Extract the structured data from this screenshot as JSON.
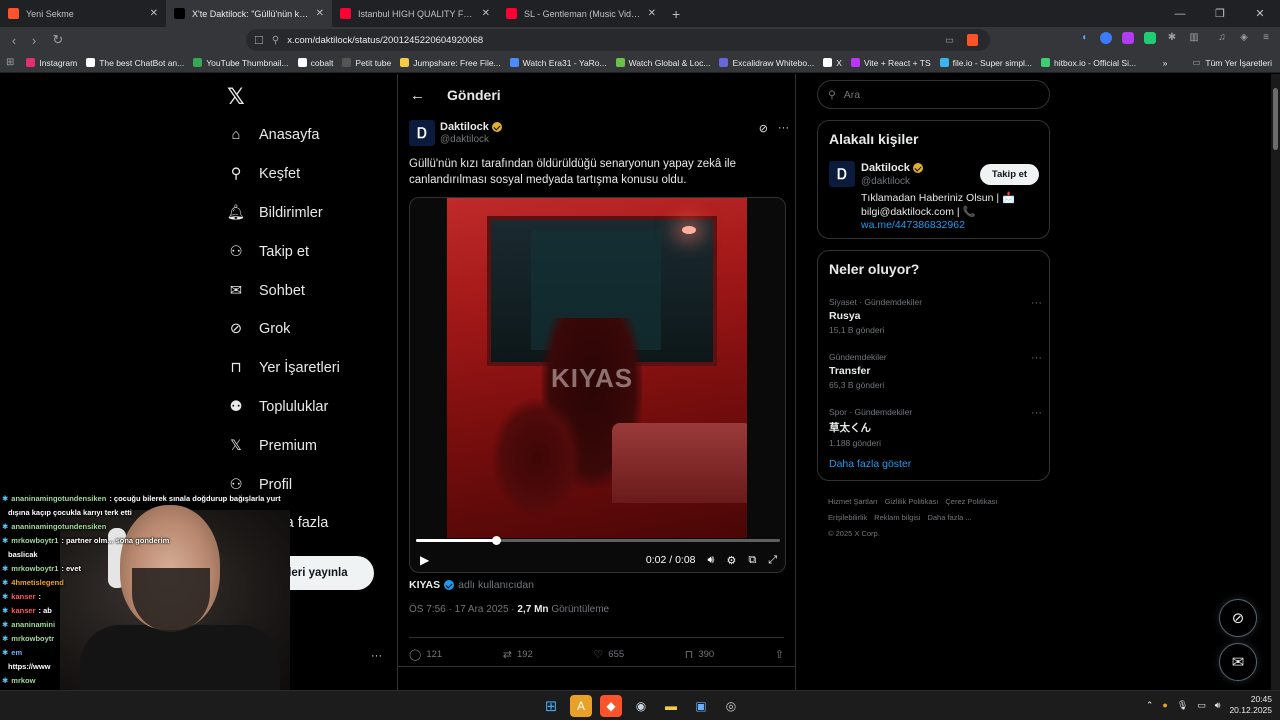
{
  "browser": {
    "tabs": [
      {
        "title": "Yeni Sekme",
        "active": false,
        "fav_color": "#fb542b"
      },
      {
        "title": "X'te Daktilock: \"Güllü'nün kızı tarafından",
        "active": true,
        "fav_color": "#000000"
      },
      {
        "title": "Istanbul HIGH QUALITY Fake Market",
        "active": false,
        "fav_color": "#ff0033"
      },
      {
        "title": "SL - Gentleman (Music Video) | @SL",
        "active": false,
        "fav_color": "#ff0033"
      }
    ],
    "new_tab": "+",
    "url": "x.com/daktilock/status/2001245220604920068",
    "bookmarks": [
      {
        "label": "Instagram",
        "color": "#e1306c"
      },
      {
        "label": "The best ChatBot an...",
        "color": "#ffffff"
      },
      {
        "label": "YouTube Thumbnail...",
        "color": "#34a853"
      },
      {
        "label": "cobalt",
        "color": "#ffffff"
      },
      {
        "label": "Petit tube",
        "color": "#555555"
      },
      {
        "label": "Jumpshare: Free File...",
        "color": "#f6c94a"
      },
      {
        "label": "Watch Era31 - YaRo...",
        "color": "#4a8cff"
      },
      {
        "label": "Watch Global & Loc...",
        "color": "#6dc04a"
      },
      {
        "label": "Excalidraw Whitebo...",
        "color": "#6965db"
      },
      {
        "label": "X",
        "color": "#ffffff"
      },
      {
        "label": "Vite + React + TS",
        "color": "#bd34fe"
      },
      {
        "label": "file.io - Super simpl...",
        "color": "#3bb4f2"
      },
      {
        "label": "hitbox.io - Official Si...",
        "color": "#3bd16f"
      }
    ],
    "bookmarks_more": "»",
    "all_bookmarks": "Tüm Yer İşaretleri"
  },
  "sidebar": {
    "items": [
      {
        "label": "Anasayfa",
        "icon": "home-icon"
      },
      {
        "label": "Keşfet",
        "icon": "search-icon"
      },
      {
        "label": "Bildirimler",
        "icon": "bell-icon"
      },
      {
        "label": "Takip et",
        "icon": "follow-icon"
      },
      {
        "label": "Sohbet",
        "icon": "mail-icon"
      },
      {
        "label": "Grok",
        "icon": "grok-icon"
      },
      {
        "label": "Yer İşaretleri",
        "icon": "bookmark-icon"
      },
      {
        "label": "Topluluklar",
        "icon": "communities-icon"
      },
      {
        "label": "Premium",
        "icon": "x-logo-icon"
      },
      {
        "label": "Profil",
        "icon": "profile-icon"
      },
      {
        "label": "Daha fazla",
        "icon": "more-icon"
      }
    ],
    "post_button": "Gönderi yayınla"
  },
  "post": {
    "header_title": "Gönderi",
    "author_name": "Daktilock",
    "author_handle": "@daktilock",
    "avatar_letter": "Ꭰ",
    "text": "Güllü'nün kızı tarafından öldürüldüğü senaryonun yapay zekâ ile canlandırılması sosyal medyada tartışma konusu oldu.",
    "video": {
      "watermark": "KIYAS",
      "time": "0:02 / 0:08",
      "progress": 0.22
    },
    "attribution_user": "KIYAS",
    "attribution_suffix": "adlı kullanıcıdan",
    "time": "ÖS 7:56 · 17 Ara 2025 · ",
    "views": "2,7 Mn",
    "views_label": "Görüntüleme",
    "stats": {
      "replies": "121",
      "reposts": "192",
      "likes": "655",
      "bookmarks": "390"
    }
  },
  "right": {
    "search_placeholder": "Ara",
    "related_title": "Alakalı kişiler",
    "related": {
      "name": "Daktilock",
      "handle": "@daktilock",
      "follow": "Takip et",
      "bio1": "Tıklamadan Haberiniz Olsun | 📩",
      "bio2": "bilgi@daktilock.com | 📞",
      "bio_link": "wa.me/447386832962"
    },
    "trends_title": "Neler oluyor?",
    "trends": [
      {
        "category": "Siyaset · Gündemdekiler",
        "name": "Rusya",
        "posts": "15,1 B gönderi"
      },
      {
        "category": "Gündemdekiler",
        "name": "Transfer",
        "posts": "65,3 B gönderi"
      },
      {
        "category": "Spor · Gündemdekiler",
        "name": "草太くん",
        "posts": "1.188 gönderi"
      }
    ],
    "show_more": "Daha fazla göster",
    "footer": [
      "Hizmet Şartları",
      "Gizlilik Politikası",
      "Çerez Politikası",
      "Erişilebilirlik",
      "Reklam bilgisi",
      "Daha fazla ...",
      "© 2025 X Corp."
    ]
  },
  "chat": [
    {
      "user": "ananinamingotundensiken",
      "text": ": çocuğu bilerek sınala doğdurup bağışlarla yurt",
      "color": "g"
    },
    {
      "user": "",
      "text": "dışına kaçıp çocukla karıyı terk etti",
      "color": "g"
    },
    {
      "user": "ananinamingotundensiken",
      "text": "",
      "color": "g"
    },
    {
      "user": "mrkowboytr1",
      "text": ": partner olm... sona gonderim",
      "color": "g"
    },
    {
      "user": "",
      "text": "baslicak",
      "color": "g"
    },
    {
      "user": "mrkowboytr1",
      "text": ": evet",
      "color": "g"
    },
    {
      "user": "4hmetislegend",
      "text": "",
      "color": "o"
    },
    {
      "user": "kanser",
      "text": ":",
      "color": "r"
    },
    {
      "user": "kanser",
      "text": ": ab",
      "color": "r"
    },
    {
      "user": "ananinamini",
      "text": "",
      "color": "g"
    },
    {
      "user": "mrkowboytr",
      "text": "",
      "color": "g"
    },
    {
      "user": "em",
      "text": "",
      "color": "b"
    },
    {
      "user": "",
      "text": "https://www",
      "color": "g"
    },
    {
      "user": "mrkow",
      "text": "",
      "color": "g"
    },
    {
      "user": "",
      "text": "",
      "color": "g"
    }
  ],
  "taskbar": {
    "time": "20:45",
    "date": "20.12.2025"
  }
}
